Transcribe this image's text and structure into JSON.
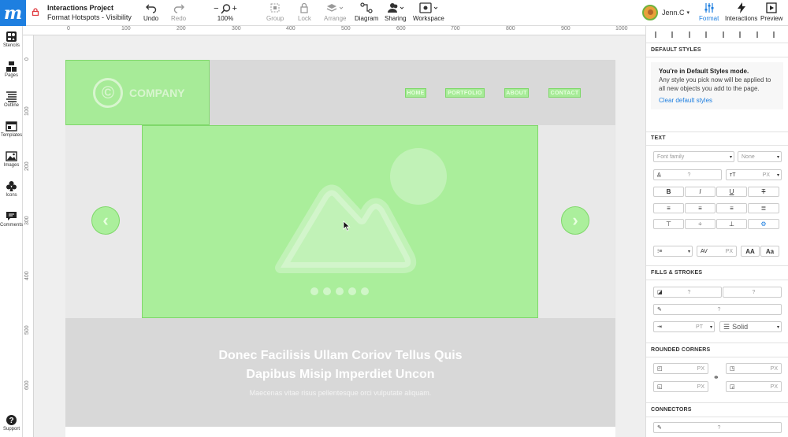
{
  "app": {
    "logo_letter": "m",
    "accent": "#1e7fe0"
  },
  "project": {
    "title": "Interactions Project",
    "page": "Format Hotspots - Visibility"
  },
  "toolbar": {
    "undo": "Undo",
    "redo": "Redo",
    "zoom": "100%",
    "zoom_minus": "−",
    "zoom_plus": "+",
    "group": "Group",
    "lock": "Lock",
    "arrange": "Arrange",
    "diagram": "Diagram",
    "sharing": "Sharing",
    "workspace": "Workspace",
    "format": "Format",
    "interactions": "Interactions",
    "preview": "Preview"
  },
  "user": {
    "name": "Jenn.C"
  },
  "leftbar": [
    {
      "label": "Stencils"
    },
    {
      "label": "Pages"
    },
    {
      "label": "Outline"
    },
    {
      "label": "Templates"
    },
    {
      "label": "Images"
    },
    {
      "label": "Icons"
    },
    {
      "label": "Comments"
    },
    {
      "label": "Support"
    }
  ],
  "ruler_top": [
    "0",
    "100",
    "200",
    "300",
    "400",
    "500",
    "600",
    "700",
    "800",
    "900",
    "1000"
  ],
  "ruler_left": [
    "0",
    "100",
    "200",
    "300",
    "400",
    "500",
    "600"
  ],
  "mockup": {
    "company": "COMPANY",
    "nav": [
      "HOME",
      "PORTFOLIO",
      "ABOUT",
      "CONTACT"
    ],
    "heading1": "Donec Facilisis Ullam Coriov Tellus Quis",
    "heading2": "Dapibus Misip Imperdiet Uncon",
    "subtext": "Maecenas vitae risus pellentesque orci vulputate aliquam.",
    "hotspot_color": "#96f082"
  },
  "panel": {
    "default_styles_title": "DEFAULT STYLES",
    "ds_heading": "You're in Default Styles mode.",
    "ds_body": "Any style you pick now will be applied to all new objects you add to the page.",
    "ds_link": "Clear default styles",
    "text_title": "TEXT",
    "font_family_placeholder": "Font family",
    "font_style": "None",
    "q": "?",
    "px": "PX",
    "pt": "PT",
    "bold": "B",
    "italic": "I",
    "underline": "U",
    "strike": "T",
    "aa_upper": "AA",
    "aa_mixed": "Aa",
    "fills_title": "FILLS & STROKES",
    "stroke_style": "Solid",
    "corners_title": "ROUNDED CORNERS",
    "connectors_title": "CONNECTORS"
  }
}
